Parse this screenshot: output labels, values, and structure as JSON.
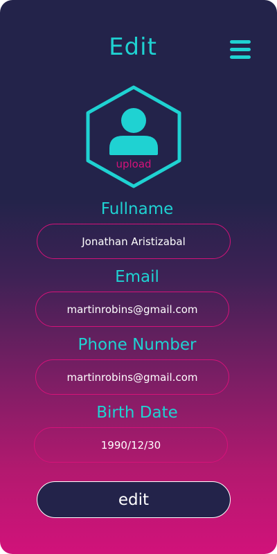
{
  "header": {
    "title": "Edit",
    "menu_icon": "hamburger-menu-icon"
  },
  "avatar": {
    "icon": "user-avatar-icon",
    "frame": "hexagon",
    "upload_label": "upload"
  },
  "form": {
    "fullname": {
      "label": "Fullname",
      "value": "Jonathan Aristizabal"
    },
    "email": {
      "label": "Email",
      "value": "martinrobins@gmail.com"
    },
    "phone": {
      "label": "Phone Number",
      "value": "martinrobins@gmail.com"
    },
    "birth_date": {
      "label": "Birth Date",
      "value": "1990/12/30"
    },
    "submit_label": "edit"
  },
  "colors": {
    "accent": "#1fd2d2",
    "pink": "#d6127a",
    "background_top": "#23234a",
    "background_bottom": "#d1127a",
    "text": "#ffffff"
  }
}
